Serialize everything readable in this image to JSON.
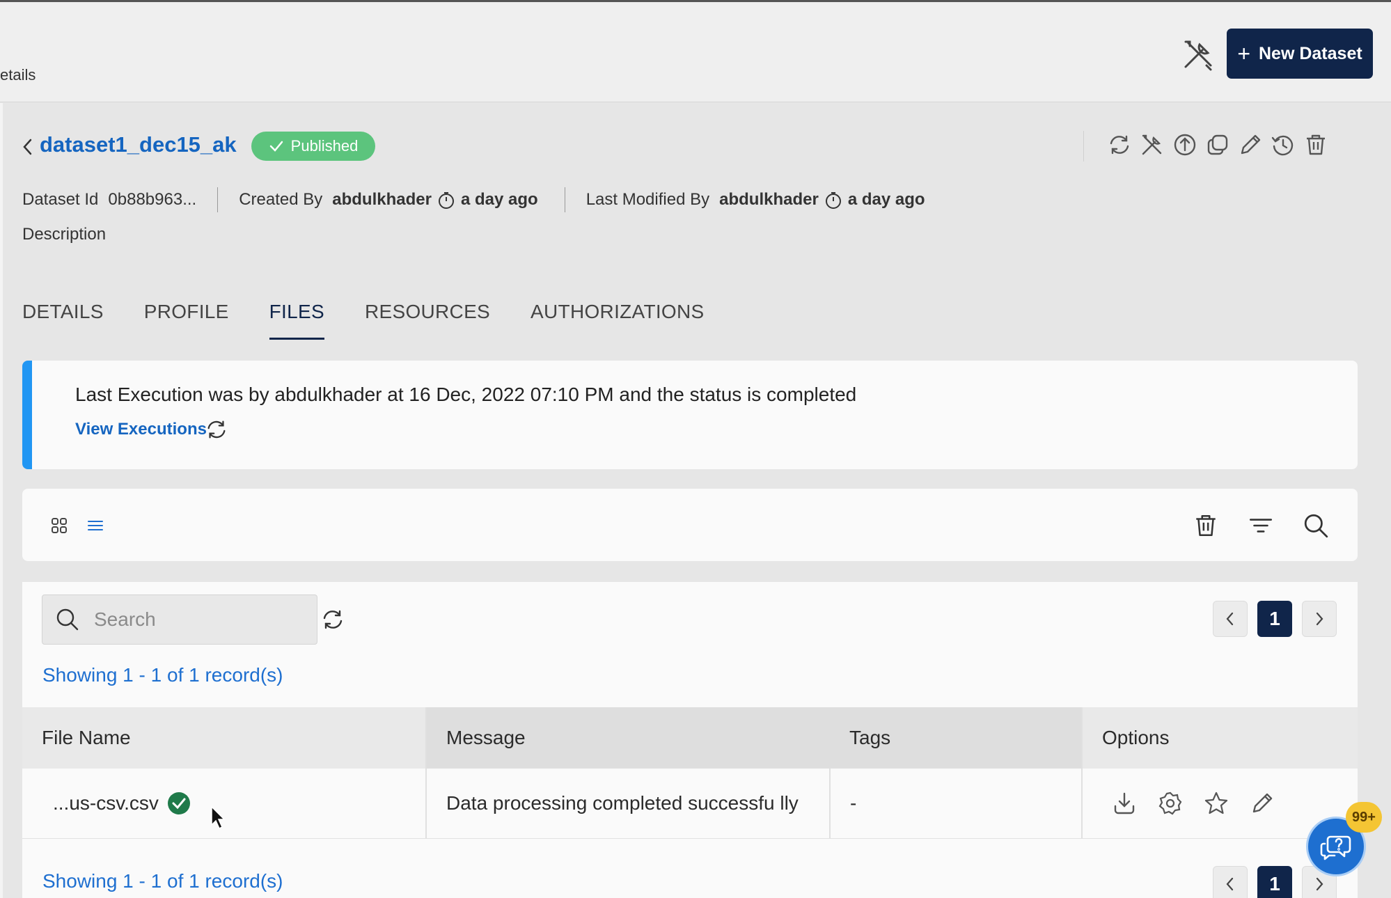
{
  "breadcrumb": {
    "tail": "etails"
  },
  "topbar": {
    "new_dataset_label": "New Dataset"
  },
  "dataset": {
    "title": "dataset1_dec15_ak",
    "status": "Published",
    "id_label": "Dataset Id",
    "id_value": "0b88b963...",
    "created_by_label": "Created By",
    "created_by": "abdulkhader",
    "created_when": "a day ago",
    "modified_by_label": "Last Modified By",
    "modified_by": "abdulkhader",
    "modified_when": "a day ago",
    "description_label": "Description"
  },
  "tabs": [
    {
      "label": "DETAILS"
    },
    {
      "label": "PROFILE"
    },
    {
      "label": "FILES",
      "active": true
    },
    {
      "label": "RESOURCES"
    },
    {
      "label": "AUTHORIZATIONS"
    }
  ],
  "execution": {
    "message": "Last Execution was by abdulkhader at 16 Dec, 2022 07:10 PM and the status is completed",
    "link": "View Executions"
  },
  "files_table": {
    "search_placeholder": "Search",
    "current_page": "1",
    "records_text": "Showing 1 - 1 of 1 record(s)",
    "columns": [
      "File Name",
      "Message",
      "Tags",
      "Options"
    ],
    "rows": [
      {
        "file_name": "...us-csv.csv",
        "message": "Data processing completed successfu lly",
        "tags": "-"
      }
    ]
  },
  "help": {
    "badge": "99+"
  },
  "colors": {
    "brand": "#10254a",
    "accent": "#1e6fd0",
    "success": "#5cc47d",
    "banner_border": "#2196f3"
  },
  "icons": {
    "header_actions": [
      "refresh-icon",
      "tools-icon",
      "upload-icon",
      "copy-icon",
      "edit-icon",
      "history-icon",
      "delete-icon"
    ],
    "row_options": [
      "download-icon",
      "settings-icon",
      "star-icon",
      "edit-icon"
    ]
  }
}
